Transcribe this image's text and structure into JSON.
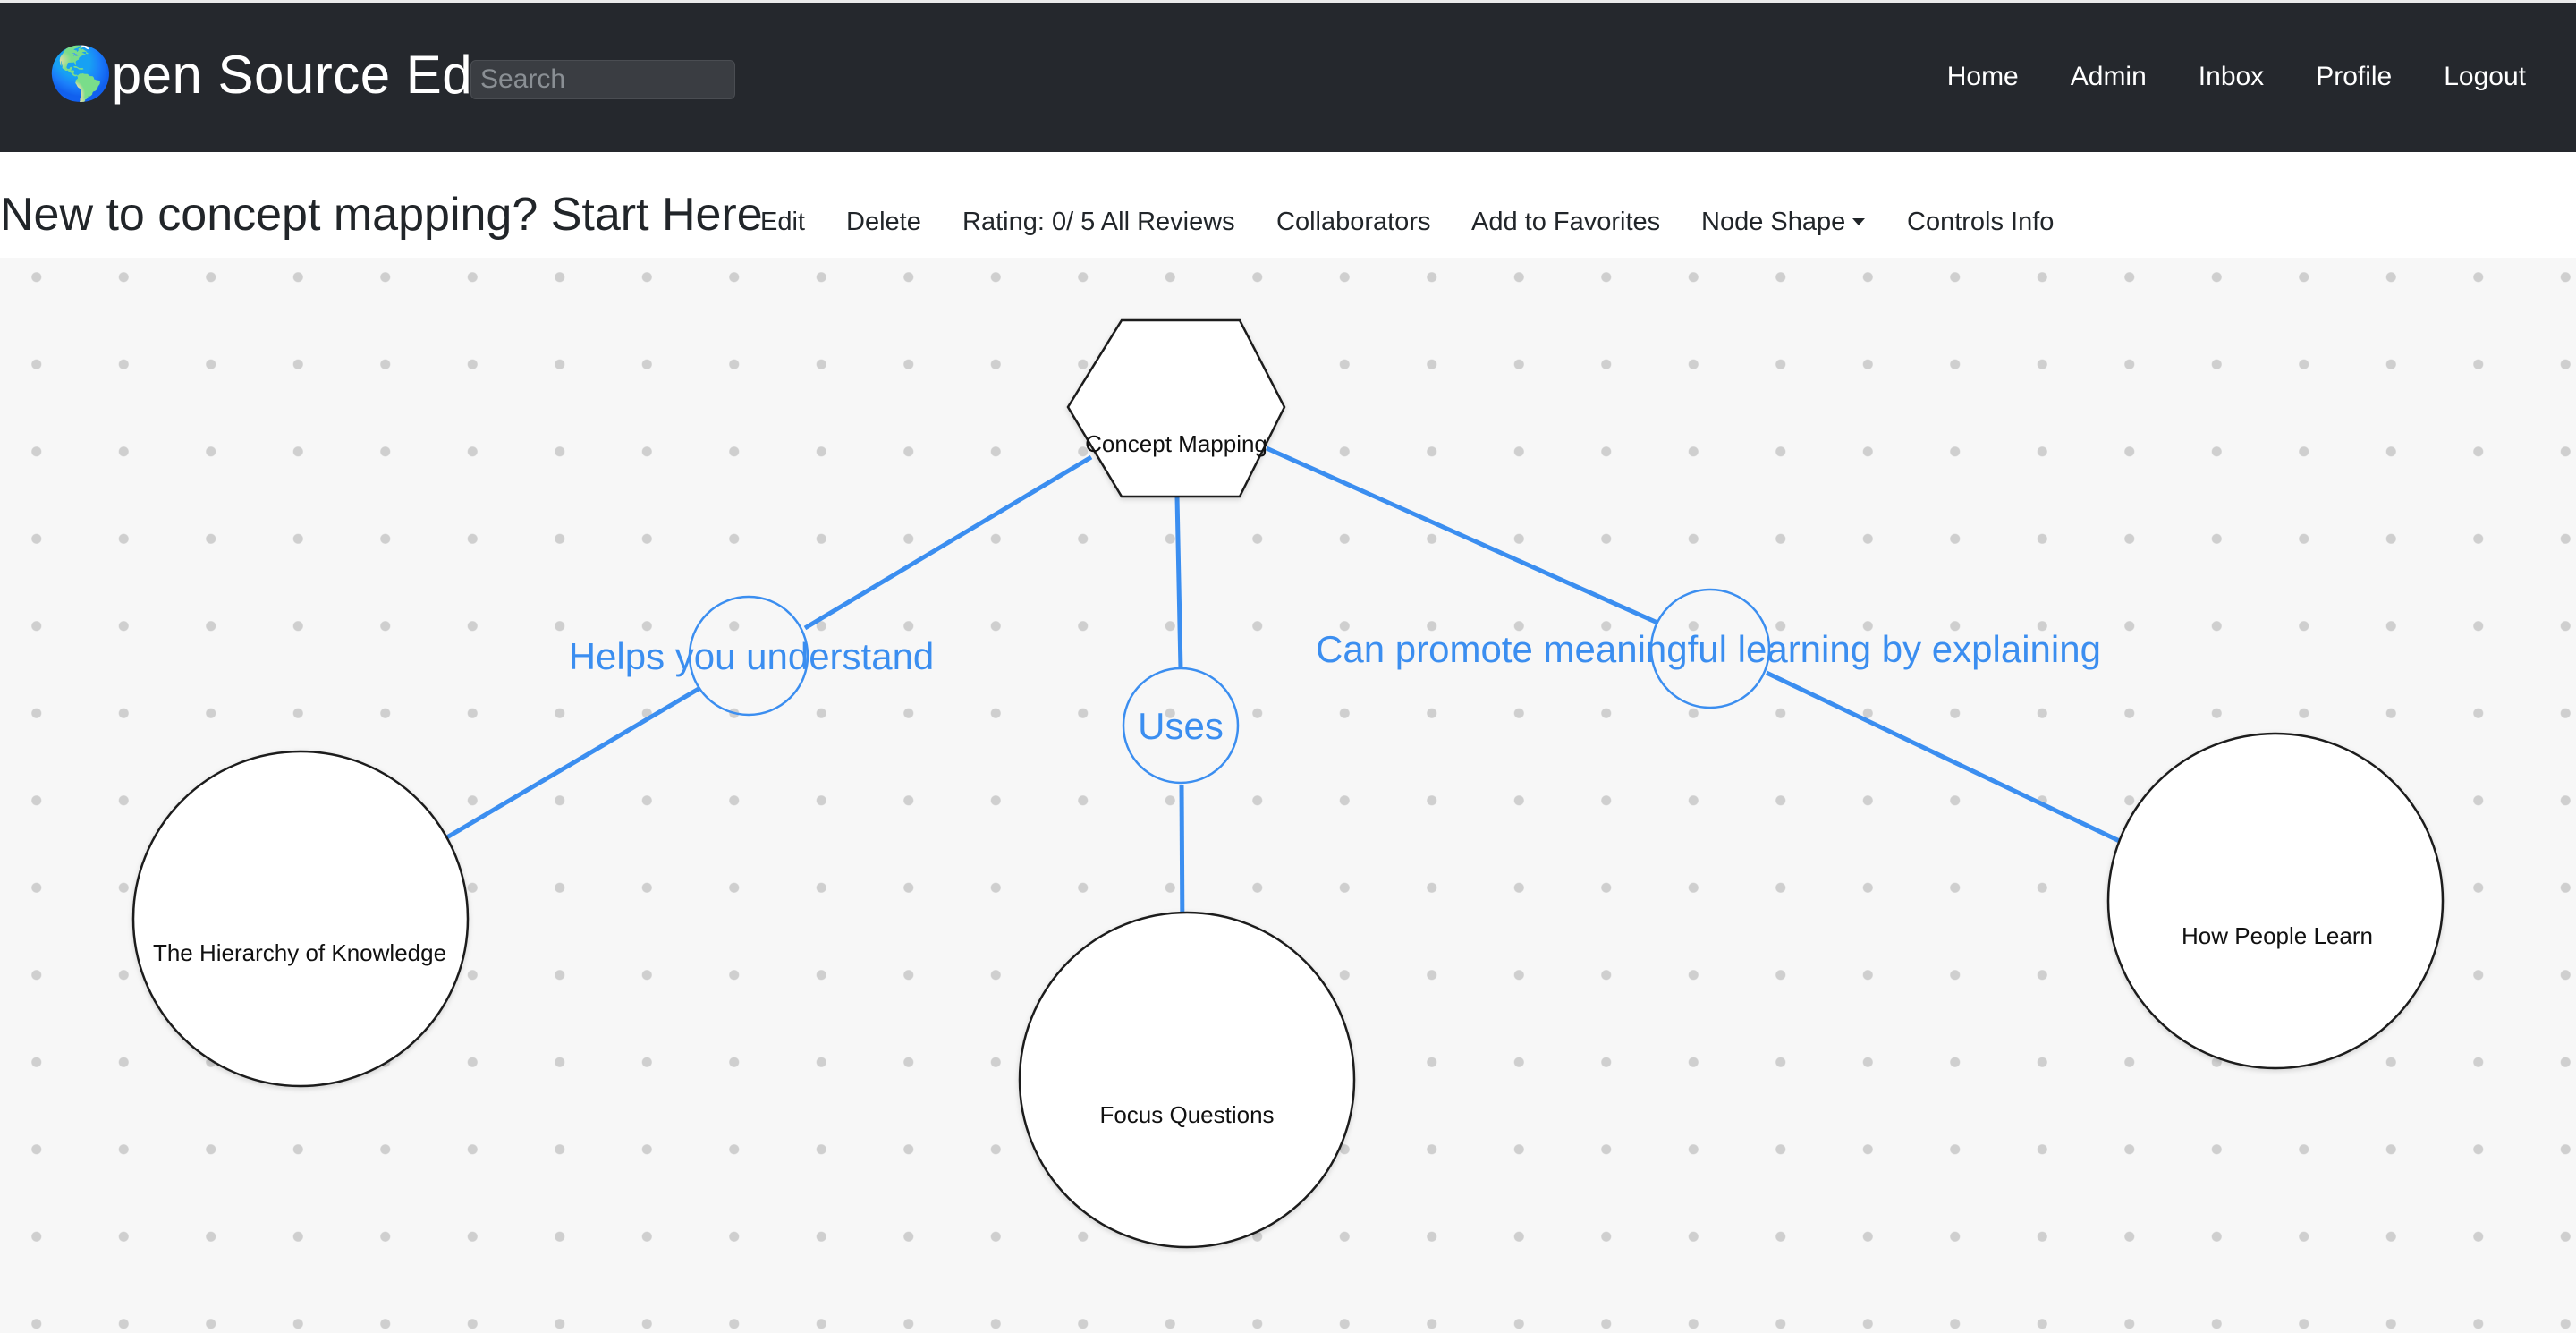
{
  "navbar": {
    "brand_icon": "🌎",
    "brand_text": "pen Source Ed",
    "search_placeholder": "Search",
    "links": [
      "Home",
      "Admin",
      "Inbox",
      "Profile",
      "Logout"
    ]
  },
  "toolbar": {
    "title": "New to concept mapping? Start Here",
    "edit": "Edit",
    "delete": "Delete",
    "rating": "Rating: 0/ 5",
    "all_reviews": "All Reviews",
    "collaborators": "Collaborators",
    "add_favorites": "Add to Favorites",
    "node_shape": "Node Shape",
    "controls_info": "Controls Info"
  },
  "map": {
    "accent_color": "#3b8ef0",
    "nodes": {
      "root": "Concept Mapping",
      "hierarchy": "The Hierarchy of Knowledge",
      "focus": "Focus Questions",
      "people": "How People Learn"
    },
    "links": {
      "helps": "Helps you understand",
      "uses": "Uses",
      "promote": "Can promote meaningful learning by explaining"
    }
  }
}
